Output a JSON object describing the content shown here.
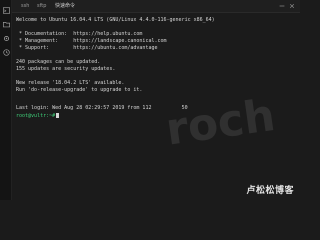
{
  "tabs": [
    {
      "label": "ssh",
      "active": false
    },
    {
      "label": "sftp",
      "active": false
    },
    {
      "label": "快速命令",
      "active": true
    }
  ],
  "sidebar": {
    "icons": [
      "terminal-icon",
      "folder-icon",
      "settings-icon",
      "history-icon"
    ]
  },
  "window_controls": [
    "minimize-icon",
    "close-icon"
  ],
  "terminal": {
    "lines": [
      "Welcome to Ubuntu 16.04.4 LTS (GNU/Linux 4.4.0-116-generic x86_64)",
      "",
      " * Documentation:  https://help.ubuntu.com",
      " * Management:     https://landscape.canonical.com",
      " * Support:        https://ubuntu.com/advantage",
      "",
      "240 packages can be updated.",
      "155 updates are security updates.",
      "",
      "New release '18.04.2 LTS' available.",
      "Run 'do-release-upgrade' to upgrade to it.",
      "",
      "",
      "Last login: Wed Aug 28 02:29:57 2019 from 112          50"
    ],
    "prompt": "root@vultr:~#"
  },
  "watermark": "卢松松博客",
  "colors": {
    "background": "#1b1b1b",
    "prompt": "#3fd07a",
    "text": "#d6d6d6"
  }
}
